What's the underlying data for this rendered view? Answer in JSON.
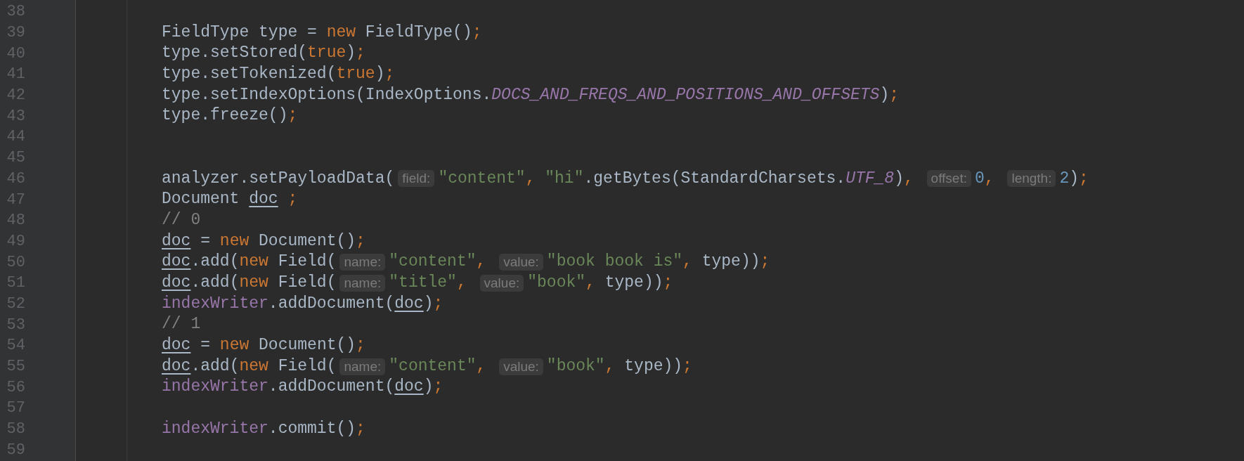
{
  "editor": {
    "lines": [
      {
        "number": "38"
      },
      {
        "number": "39",
        "tokens": [
          {
            "kind": "text",
            "text": "FieldType type = "
          },
          {
            "kind": "keyword",
            "text": "new"
          },
          {
            "kind": "text",
            "text": " FieldType()"
          },
          {
            "kind": "punct",
            "text": ";"
          }
        ]
      },
      {
        "number": "40",
        "tokens": [
          {
            "kind": "text",
            "text": "type.setStored("
          },
          {
            "kind": "keyword",
            "text": "true"
          },
          {
            "kind": "text",
            "text": ")"
          },
          {
            "kind": "punct",
            "text": ";"
          }
        ]
      },
      {
        "number": "41",
        "tokens": [
          {
            "kind": "text",
            "text": "type.setTokenized("
          },
          {
            "kind": "keyword",
            "text": "true"
          },
          {
            "kind": "text",
            "text": ")"
          },
          {
            "kind": "punct",
            "text": ";"
          }
        ]
      },
      {
        "number": "42",
        "tokens": [
          {
            "kind": "text",
            "text": "type.setIndexOptions(IndexOptions."
          },
          {
            "kind": "constant",
            "text": "DOCS_AND_FREQS_AND_POSITIONS_AND_OFFSETS"
          },
          {
            "kind": "text",
            "text": ")"
          },
          {
            "kind": "punct",
            "text": ";"
          }
        ]
      },
      {
        "number": "43",
        "tokens": [
          {
            "kind": "text",
            "text": "type.freeze()"
          },
          {
            "kind": "punct",
            "text": ";"
          }
        ]
      },
      {
        "number": "44"
      },
      {
        "number": "45"
      },
      {
        "number": "46",
        "tokens": [
          {
            "kind": "text",
            "text": "analyzer.setPayloadData("
          },
          {
            "kind": "hint",
            "text": "field:"
          },
          {
            "kind": "string",
            "text": "\"content\""
          },
          {
            "kind": "punct",
            "text": ", "
          },
          {
            "kind": "string",
            "text": "\"hi\""
          },
          {
            "kind": "text",
            "text": ".getBytes(StandardCharsets."
          },
          {
            "kind": "constant",
            "text": "UTF_8"
          },
          {
            "kind": "text",
            "text": ")"
          },
          {
            "kind": "punct",
            "text": ", "
          },
          {
            "kind": "hint",
            "text": "offset:"
          },
          {
            "kind": "number",
            "text": "0"
          },
          {
            "kind": "punct",
            "text": ", "
          },
          {
            "kind": "hint",
            "text": "length:"
          },
          {
            "kind": "number",
            "text": "2"
          },
          {
            "kind": "text",
            "text": ")"
          },
          {
            "kind": "punct",
            "text": ";"
          }
        ]
      },
      {
        "number": "47",
        "tokens": [
          {
            "kind": "text",
            "text": "Document "
          },
          {
            "kind": "local",
            "text": "doc"
          },
          {
            "kind": "punct",
            "text": " ;"
          }
        ]
      },
      {
        "number": "48",
        "tokens": [
          {
            "kind": "comment",
            "text": "// 0"
          }
        ]
      },
      {
        "number": "49",
        "tokens": [
          {
            "kind": "local",
            "text": "doc"
          },
          {
            "kind": "text",
            "text": " = "
          },
          {
            "kind": "keyword",
            "text": "new"
          },
          {
            "kind": "text",
            "text": " Document()"
          },
          {
            "kind": "punct",
            "text": ";"
          }
        ]
      },
      {
        "number": "50",
        "tokens": [
          {
            "kind": "local",
            "text": "doc"
          },
          {
            "kind": "text",
            "text": ".add("
          },
          {
            "kind": "keyword",
            "text": "new"
          },
          {
            "kind": "text",
            "text": " Field("
          },
          {
            "kind": "hint",
            "text": "name:"
          },
          {
            "kind": "string",
            "text": "\"content\""
          },
          {
            "kind": "punct",
            "text": ", "
          },
          {
            "kind": "hint",
            "text": "value:"
          },
          {
            "kind": "string",
            "text": "\"book book is\""
          },
          {
            "kind": "punct",
            "text": ", "
          },
          {
            "kind": "text",
            "text": "type))"
          },
          {
            "kind": "punct",
            "text": ";"
          }
        ]
      },
      {
        "number": "51",
        "tokens": [
          {
            "kind": "local",
            "text": "doc"
          },
          {
            "kind": "text",
            "text": ".add("
          },
          {
            "kind": "keyword",
            "text": "new"
          },
          {
            "kind": "text",
            "text": " Field("
          },
          {
            "kind": "hint",
            "text": "name:"
          },
          {
            "kind": "string",
            "text": "\"title\""
          },
          {
            "kind": "punct",
            "text": ", "
          },
          {
            "kind": "hint",
            "text": "value:"
          },
          {
            "kind": "string",
            "text": "\"book\""
          },
          {
            "kind": "punct",
            "text": ", "
          },
          {
            "kind": "text",
            "text": "type))"
          },
          {
            "kind": "punct",
            "text": ";"
          }
        ]
      },
      {
        "number": "52",
        "tokens": [
          {
            "kind": "field",
            "text": "indexWriter"
          },
          {
            "kind": "text",
            "text": ".addDocument("
          },
          {
            "kind": "local",
            "text": "doc"
          },
          {
            "kind": "text",
            "text": ")"
          },
          {
            "kind": "punct",
            "text": ";"
          }
        ]
      },
      {
        "number": "53",
        "tokens": [
          {
            "kind": "comment",
            "text": "// 1"
          }
        ]
      },
      {
        "number": "54",
        "tokens": [
          {
            "kind": "local",
            "text": "doc"
          },
          {
            "kind": "text",
            "text": " = "
          },
          {
            "kind": "keyword",
            "text": "new"
          },
          {
            "kind": "text",
            "text": " Document()"
          },
          {
            "kind": "punct",
            "text": ";"
          }
        ]
      },
      {
        "number": "55",
        "tokens": [
          {
            "kind": "local",
            "text": "doc"
          },
          {
            "kind": "text",
            "text": ".add("
          },
          {
            "kind": "keyword",
            "text": "new"
          },
          {
            "kind": "text",
            "text": " Field("
          },
          {
            "kind": "hint",
            "text": "name:"
          },
          {
            "kind": "string",
            "text": "\"content\""
          },
          {
            "kind": "punct",
            "text": ", "
          },
          {
            "kind": "hint",
            "text": "value:"
          },
          {
            "kind": "string",
            "text": "\"book\""
          },
          {
            "kind": "punct",
            "text": ", "
          },
          {
            "kind": "text",
            "text": "type))"
          },
          {
            "kind": "punct",
            "text": ";"
          }
        ]
      },
      {
        "number": "56",
        "tokens": [
          {
            "kind": "field",
            "text": "indexWriter"
          },
          {
            "kind": "text",
            "text": ".addDocument("
          },
          {
            "kind": "local",
            "text": "doc"
          },
          {
            "kind": "text",
            "text": ")"
          },
          {
            "kind": "punct",
            "text": ";"
          }
        ]
      },
      {
        "number": "57"
      },
      {
        "number": "58",
        "tokens": [
          {
            "kind": "field",
            "text": "indexWriter"
          },
          {
            "kind": "text",
            "text": ".commit()"
          },
          {
            "kind": "punct",
            "text": ";"
          }
        ]
      },
      {
        "number": "59"
      }
    ]
  }
}
